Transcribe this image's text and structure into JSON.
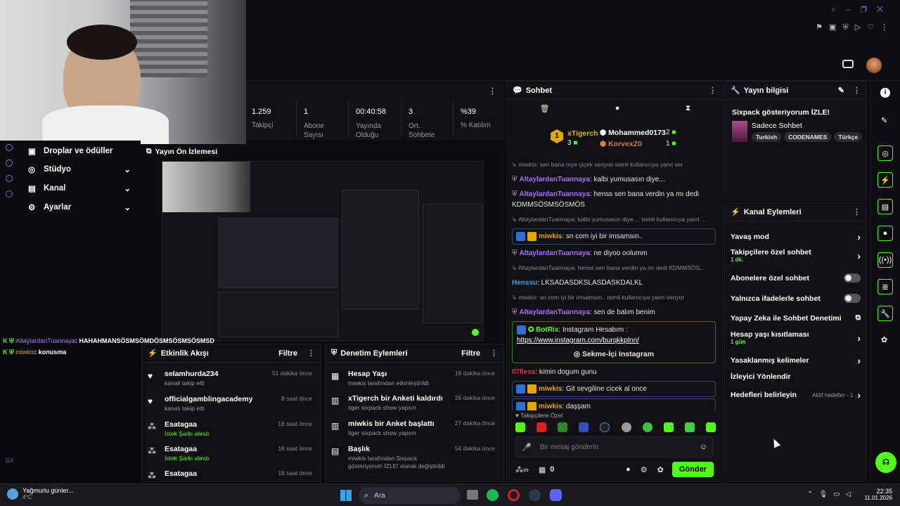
{
  "stats": [
    {
      "value": "1.259",
      "label": "Takipçi"
    },
    {
      "value": "1",
      "label": "Abone Sayısı"
    },
    {
      "value": "00:40:58",
      "label": "Yayında Olduğu"
    },
    {
      "value": "3",
      "label": "Ort. Sohbete"
    },
    {
      "value": "%39",
      "label": "% Katılım"
    }
  ],
  "nav": {
    "items": [
      {
        "label": "Droplar ve ödüller"
      },
      {
        "label": "Stüdyo"
      },
      {
        "label": "Kanal"
      },
      {
        "label": "Ayarlar"
      }
    ]
  },
  "preview": {
    "title": "Yayın Ön İzlemesi"
  },
  "overlay_chat": [
    {
      "user": "AltaylardanTuannaya",
      "text": ": HAHAHMANSÖSMSÖMDÖSMSÖSMSÖSMSD"
    },
    {
      "user": "miwkis",
      "text": ": konusma"
    }
  ],
  "chat": {
    "title": "Sohbet",
    "leaderboard": {
      "first": {
        "name": "xTigerch",
        "count": "3"
      },
      "second": {
        "name": "Mohammed0173",
        "count": "2"
      },
      "third": {
        "name": "KorvexZ0",
        "count": "1"
      }
    },
    "messages": [
      {
        "kind": "reply",
        "text": "miwkis: sen bana mye çiçek veriyon isimli kullanıcıya yanıt ver"
      },
      {
        "user": "AltaylardanTuannaya",
        "text": ": kalbi yumusasın diye..."
      },
      {
        "user": "AltaylardanTuannaya",
        "text": ": henss sen bana verdin ya mı dedi KDMMSÖSMSÖSMÖS"
      },
      {
        "kind": "reply",
        "text": "AltaylardanTuannaya: kalbi yumusasın diye.... isimli kullanıcıya yanıt ..."
      },
      {
        "user": "miwkis",
        "text": ": sn com iyi bir imsamsın.."
      },
      {
        "user": "AltaylardanTuannaya",
        "text": ": ne diyoo oolumm"
      },
      {
        "kind": "reply",
        "text": "AltaylardanTuannaya: henss sen bana verdin ya mı dedi KDMMSÖS..."
      },
      {
        "user": "Henssu",
        "text": ": LKSADASDKSLASDASKDALKL"
      },
      {
        "kind": "reply",
        "text": "miwkis: sn com iyi bir imsamsın.. isimli kullanıcıya yanıt veriyor"
      },
      {
        "user": "AltaylardanTuannaya",
        "text": ": sen de balım benim"
      }
    ],
    "bot": {
      "user": "BotRix",
      "text": ": Instagram Hesabım :",
      "link": "https://www.instagram.com/burqkkplnn/",
      "button": "Sekme-İçi Instagram"
    },
    "messages2": [
      {
        "user": "07lless",
        "text": ": kimin dogum gunu"
      },
      {
        "user": "miwkis",
        "text": ": Git sevgiline cicek al once"
      },
      {
        "user": "miwkis",
        "text": ": daşşam"
      },
      {
        "user": "AltaylardanTuannaya",
        "text": ":"
      },
      {
        "user": "",
        "text": "HAHAHMANSÖSMSÖMDÖSMSÖSMSÖSMSD"
      },
      {
        "user": "miwkis",
        "text": ": konusma"
      }
    ],
    "followers_label": "Takipçilere Özel",
    "input_placeholder": "Bir mesaj gönderin",
    "counter": "0",
    "send": "Gönder"
  },
  "stream_info": {
    "title": "Yayın bilgisi",
    "stream_title": "Sixpack gösteriyorum İZLE!",
    "category": "Sadece Sohbet",
    "tags": [
      "Turkish",
      "CODENAMES",
      "Türkçe"
    ]
  },
  "channel_actions": {
    "title": "Kanal Eylemleri",
    "items": [
      {
        "label": "Yavaş mod",
        "sub": "",
        "ctrl": "chevron"
      },
      {
        "label": "Takipçilere özel sohbet",
        "sub": "1 dk.",
        "ctrl": "chevron"
      },
      {
        "label": "Abonelere özel sohbet",
        "sub": "",
        "ctrl": "toggle"
      },
      {
        "label": "Yalnızca ifadelerle sohbet",
        "sub": "",
        "ctrl": "toggle"
      },
      {
        "label": "Yapay Zeka ile Sohbet Denetimi",
        "sub": "",
        "ctrl": "external"
      },
      {
        "label": "Hesap yaşı kısıtlaması",
        "sub": "1 gün",
        "ctrl": "chevron"
      },
      {
        "label": "Yasaklanmış kelimeler",
        "sub": "",
        "ctrl": "chevron"
      },
      {
        "label": "İzleyici Yönlendir",
        "sub": "",
        "ctrl": ""
      },
      {
        "label": "Hedefleri belirleyin",
        "sub": "",
        "ctrl": "chevron",
        "extra": "Aktif hedefler - 1"
      }
    ]
  },
  "activity": {
    "title": "Etkinlik Akışı",
    "filter": "Filtre",
    "items": [
      {
        "title": "selamhurda234",
        "sub": "kanalı takip etti",
        "time": "51 dakika önce",
        "icon": "heart"
      },
      {
        "title": "officialgamblingacademy",
        "sub": "kanalı takip etti",
        "time": "8 saat önce",
        "icon": "heart"
      },
      {
        "title": "Esatagaa",
        "sub": "İstek Şarkı alındı",
        "time": "18 saat önce",
        "icon": "reward"
      },
      {
        "title": "Esatagaa",
        "sub": "İstek Şarkı alındı",
        "time": "18 saat önce",
        "icon": "reward"
      },
      {
        "title": "Esatagaa",
        "sub": "",
        "time": "18 saat önce",
        "icon": "reward"
      }
    ]
  },
  "moderation": {
    "title": "Denetim Eylemleri",
    "filter": "Filtre",
    "items": [
      {
        "title": "Hesap Yaşı",
        "sub": "miwkis tarafından etkinleştirildi",
        "time": "19 dakika önce"
      },
      {
        "title": "xTigerch bir Anketi kaldırdı",
        "sub": "tiger sixpack show yapsın",
        "time": "26 dakika önce"
      },
      {
        "title": "miwkis bir Anket başlattı",
        "sub": "tiger sixpack show yapsın",
        "time": "27 dakika önce"
      },
      {
        "title": "Başlık",
        "sub": "miwkis tarafından Sixpack gösteriyorum İZLE! olarak değiştirildi",
        "time": "54 dakika önce"
      }
    ]
  },
  "taskbar": {
    "weather_title": "Yağmurlu günler...",
    "weather_temp": "4°C",
    "search": "Ara",
    "time": "22:35",
    "date": "11.01.2026"
  },
  "colors": {
    "accent": "#53fc18",
    "bg": "#0a0a0c",
    "panel": "#111114",
    "username": "#a970ff"
  }
}
